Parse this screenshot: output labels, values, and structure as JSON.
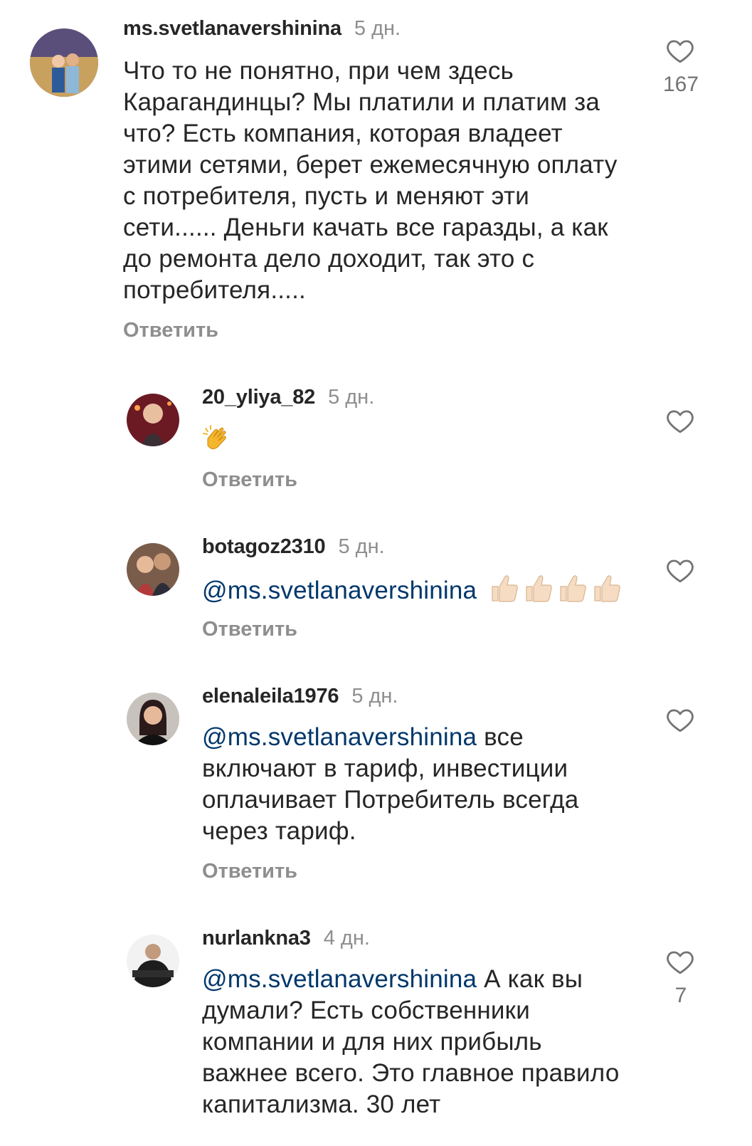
{
  "comments": [
    {
      "username": "ms.svetlanavershinina",
      "time": "5 дн.",
      "text": "Что то не понятно, при чем  здесь Карагандинцы?  Мы платили и платим за  что?  Есть компания, которая владеет этими сетями, берет ежемесячную оплату с  потребителя, пусть и меняют эти сети...... Деньги качать все гаразды, а как до ремонта дело доходит, так это с потребителя.....",
      "reply_label": "Ответить",
      "likes": "167"
    },
    {
      "username": "20_yliya_82",
      "time": "5 дн.",
      "emoji": "clapping-hands",
      "reply_label": "Ответить",
      "likes": ""
    },
    {
      "username": "botagoz2310",
      "time": "5 дн.",
      "mention": "@ms.svetlanavershinina",
      "emoji": "thumbs-up x4",
      "reply_label": "Ответить",
      "likes": ""
    },
    {
      "username": "elenaleila1976",
      "time": "5 дн.",
      "mention": "@ms.svetlanavershinina",
      "text": "все включают в тариф, инвестиции оплачивает Потребитель всегда через тариф.",
      "reply_label": "Ответить",
      "likes": ""
    },
    {
      "username": "nurlankna3",
      "time": "4 дн.",
      "mention": "@ms.svetlanavershinina",
      "text": "А как вы думали? Есть собственники компании и для них прибыль важнее всего. Это главное правило капитализма. 30 лет",
      "likes": "7"
    }
  ],
  "colors": {
    "username": "#262626",
    "meta": "#8e8e8e",
    "mention": "#00376b"
  }
}
